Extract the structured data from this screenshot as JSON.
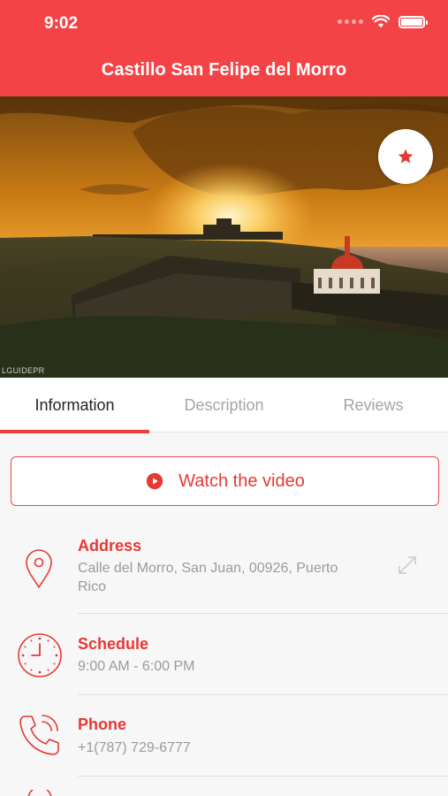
{
  "status_bar": {
    "time": "9:02"
  },
  "header": {
    "title": "Castillo San Felipe del Morro"
  },
  "hero": {
    "watermark": "LGUIDEPR",
    "favorite_icon": "star-icon"
  },
  "tabs": [
    {
      "label": "Information",
      "active": true
    },
    {
      "label": "Description",
      "active": false
    },
    {
      "label": "Reviews",
      "active": false
    }
  ],
  "video_button": {
    "label": "Watch the video",
    "icon": "play-circle-icon"
  },
  "info": {
    "address": {
      "label": "Address",
      "value": "Calle del Morro, San Juan, 00926, Puerto Rico",
      "icon": "location-pin-icon"
    },
    "schedule": {
      "label": "Schedule",
      "value": "9:00 AM - 6:00 PM",
      "icon": "clock-icon"
    },
    "phone": {
      "label": "Phone",
      "value": "+1(787) 729-6777",
      "icon": "phone-icon"
    }
  },
  "colors": {
    "accent": "#f44346",
    "label_red": "#e53935",
    "muted_text": "#9b9b9b"
  }
}
